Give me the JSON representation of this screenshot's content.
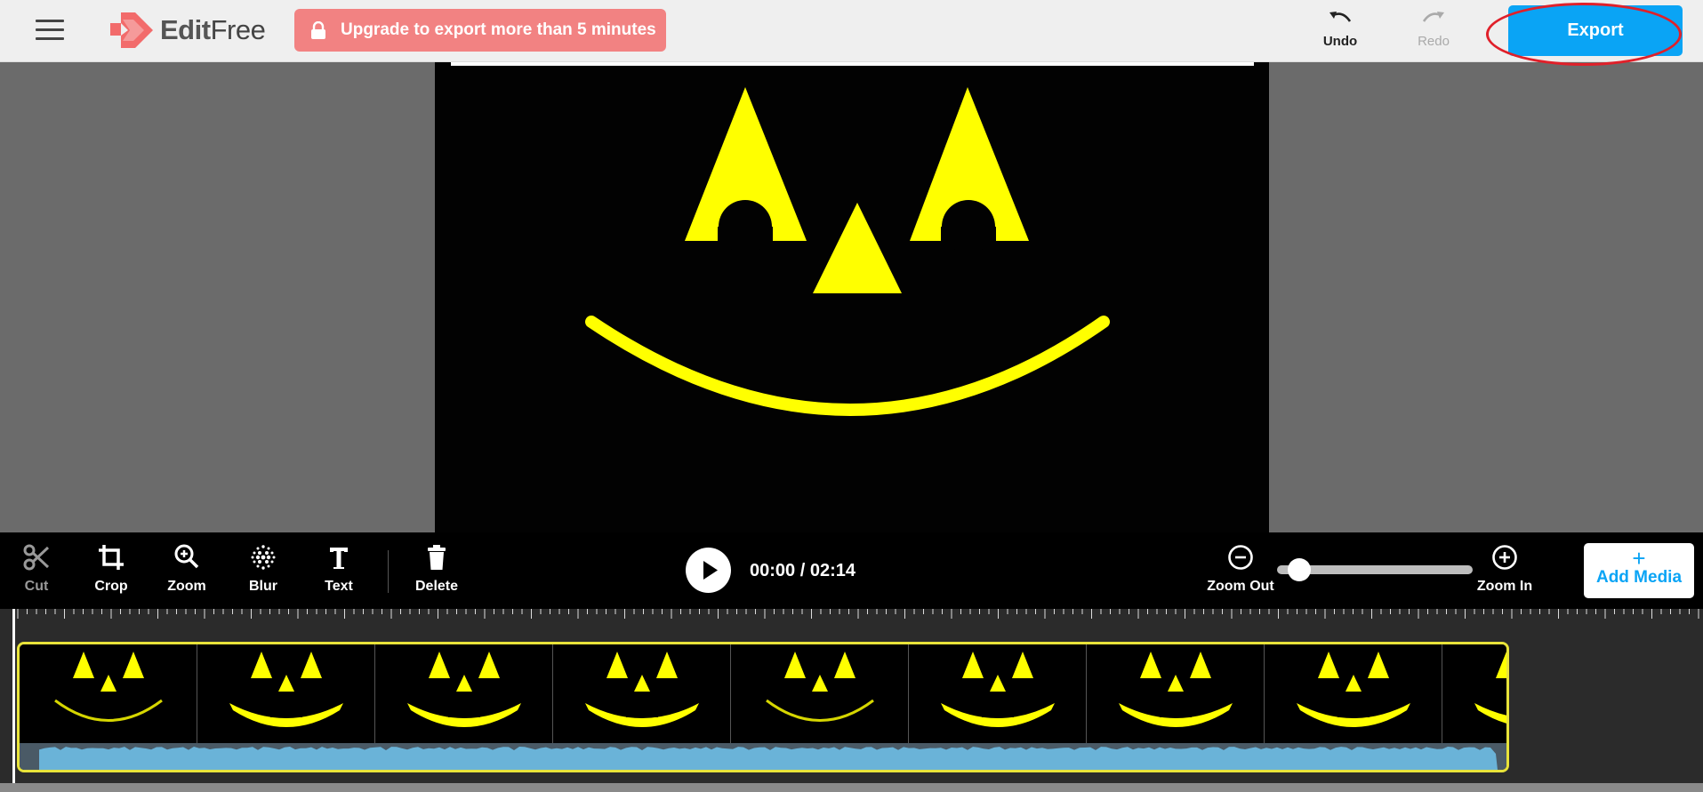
{
  "app": {
    "name_bold": "Edit",
    "name_rest": "Free"
  },
  "header": {
    "upgrade_label": "Upgrade to export more than 5 minutes",
    "undo_label": "Undo",
    "redo_label": "Redo",
    "export_label": "Export"
  },
  "toolbar": {
    "tools": [
      {
        "label": "Cut",
        "icon": "scissors-icon",
        "enabled": false
      },
      {
        "label": "Crop",
        "icon": "crop-icon",
        "enabled": true
      },
      {
        "label": "Zoom",
        "icon": "zoom-icon",
        "enabled": true
      },
      {
        "label": "Blur",
        "icon": "blur-icon",
        "enabled": true
      },
      {
        "label": "Text",
        "icon": "text-icon",
        "enabled": true
      },
      {
        "label": "Delete",
        "icon": "trash-icon",
        "enabled": true
      }
    ],
    "time": "00:00 / 02:14",
    "zoom_out_label": "Zoom Out",
    "zoom_in_label": "Zoom In",
    "zoom_level": 0.1,
    "add_media_label": "Add Media"
  },
  "colors": {
    "accent": "#0aa4f5",
    "upgrade": "#f28282",
    "clip_border": "#e8e33a",
    "face": "#ffff00",
    "highlight_ring": "#e0202a",
    "audio_wave": "#6ab3d8"
  }
}
